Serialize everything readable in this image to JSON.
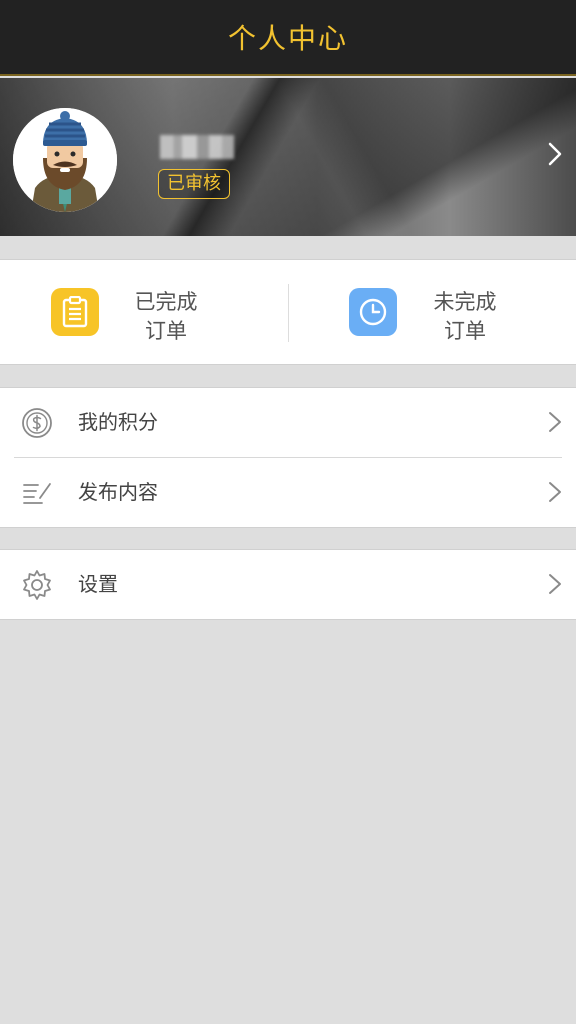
{
  "header": {
    "title": "个人中心"
  },
  "profile": {
    "avatar_icon": "avatar-illustration",
    "status_badge": "已审核",
    "arrow_icon": "chevron-right-icon"
  },
  "orders": [
    {
      "line1": "已完成",
      "line2": "订单",
      "icon": "clipboard-icon",
      "color": "#f7c427"
    },
    {
      "line1": "未完成",
      "line2": "订单",
      "icon": "clock-icon",
      "color": "#6aaef5"
    }
  ],
  "menu": {
    "group1": [
      {
        "label": "我的积分",
        "icon": "coin-icon"
      },
      {
        "label": "发布内容",
        "icon": "edit-list-icon"
      }
    ],
    "group2": [
      {
        "label": "设置",
        "icon": "gear-icon"
      }
    ]
  },
  "colors": {
    "accent": "#f2c230",
    "topbar": "#222222",
    "background": "#dedede"
  }
}
